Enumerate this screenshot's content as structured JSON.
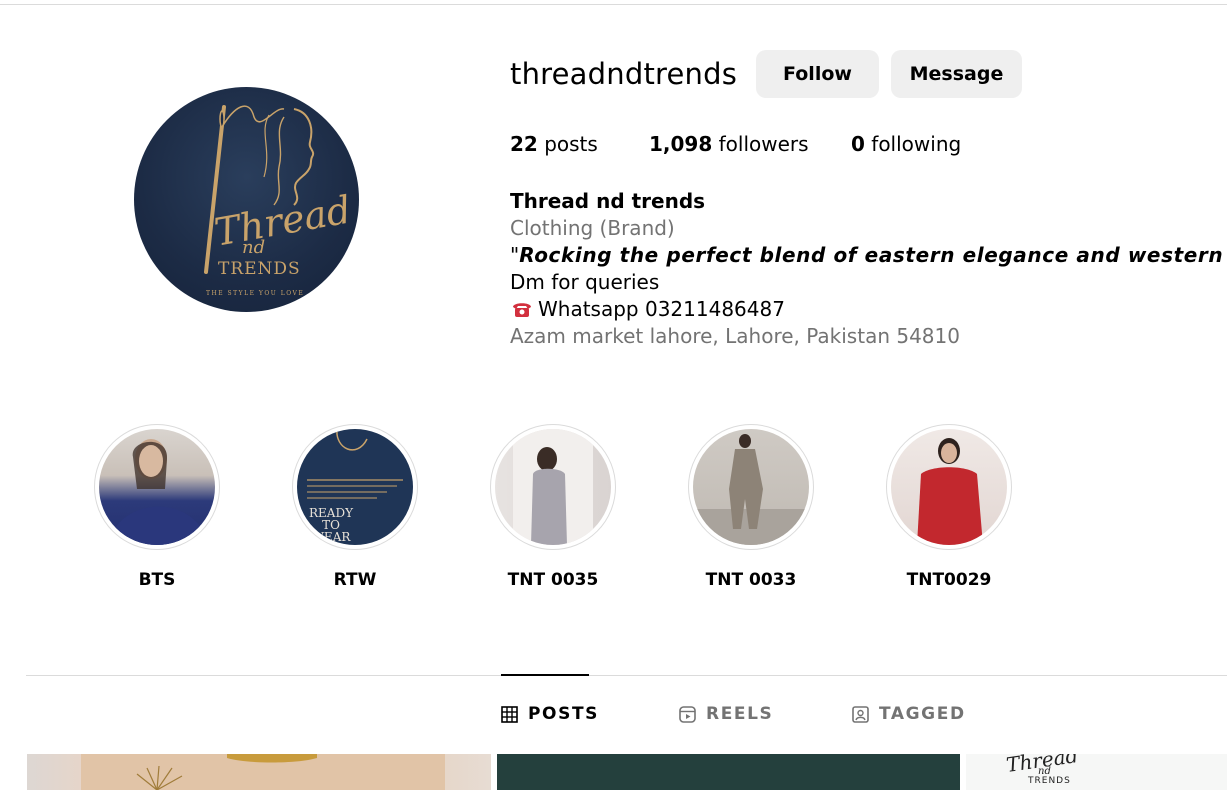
{
  "profile": {
    "username": "threadndtrends",
    "follow_label": "Follow",
    "message_label": "Message",
    "avatar_logo": {
      "line1": "Thread",
      "line2": "nd",
      "line3": "TRENDS",
      "tagline": "THE STYLE YOU LOVE"
    }
  },
  "stats": {
    "posts_count": "22",
    "posts_label": "posts",
    "followers_count": "1,098",
    "followers_label": "followers",
    "following_count": "0",
    "following_label": "following"
  },
  "bio": {
    "name": "Thread nd trends",
    "category": "Clothing (Brand)",
    "quote_open": "\"",
    "quote_text": "Rocking the perfect blend of eastern elegance and western flair",
    "quote_close": "!",
    "line_dm": "Dm for queries",
    "whatsapp": "Whatsapp 03211486487",
    "address": "Azam market lahore, Lahore, Pakistan 54810"
  },
  "highlights": [
    {
      "label": "BTS"
    },
    {
      "label": "RTW",
      "cover_text": "READY TO WEAR"
    },
    {
      "label": "TNT 0035"
    },
    {
      "label": "TNT 0033"
    },
    {
      "label": "TNT0029"
    }
  ],
  "tabs": {
    "posts": "POSTS",
    "reels": "REELS",
    "tagged": "TAGGED",
    "active": "posts"
  },
  "post_thumb_text": {
    "line1": "Thread",
    "line2": "nd",
    "line3": "TRENDS"
  },
  "colors": {
    "button_bg": "#efefef",
    "muted_text": "#737373",
    "avatar_bg": "#1c2b45",
    "gold": "#c9a36a",
    "divider": "#dbdbdb"
  },
  "icons": {
    "phone": "telephone-icon",
    "posts_tab": "grid-icon",
    "reels_tab": "reels-icon",
    "tagged_tab": "tagged-person-icon"
  }
}
